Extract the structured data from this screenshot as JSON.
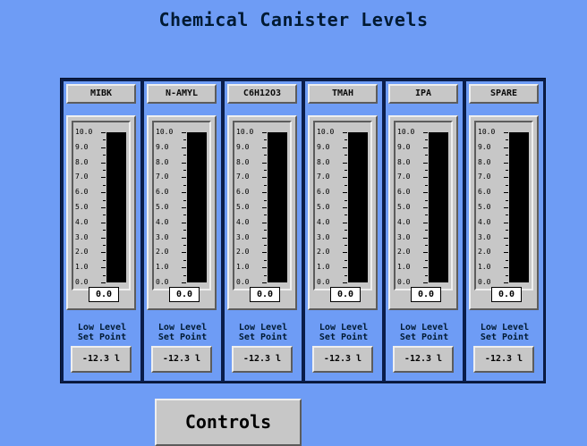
{
  "title": "Chemical Canister Levels",
  "scale_labels": [
    "10.0",
    "9.0",
    "8.0",
    "7.0",
    "6.0",
    "5.0",
    "4.0",
    "3.0",
    "2.0",
    "1.0",
    "0.0"
  ],
  "setpoint_label_line1": "Low Level",
  "setpoint_label_line2": "Set Point",
  "canisters": [
    {
      "name": "MIBK",
      "level": 0,
      "value": "0.0",
      "setpoint": "-12.3 l"
    },
    {
      "name": "N-AMYL",
      "level": 0,
      "value": "0.0",
      "setpoint": "-12.3 l"
    },
    {
      "name": "C6H12O3",
      "level": 0,
      "value": "0.0",
      "setpoint": "-12.3 l"
    },
    {
      "name": "TMAH",
      "level": 0,
      "value": "0.0",
      "setpoint": "-12.3 l"
    },
    {
      "name": "IPA",
      "level": 0,
      "value": "0.0",
      "setpoint": "-12.3 l"
    },
    {
      "name": "SPARE",
      "level": 0,
      "value": "0.0",
      "setpoint": "-12.3 l"
    }
  ],
  "controls_label": "Controls",
  "colors": {
    "background": "#6e9cf5",
    "bar_empty": "#000000",
    "frame": "#c7c7c7"
  }
}
